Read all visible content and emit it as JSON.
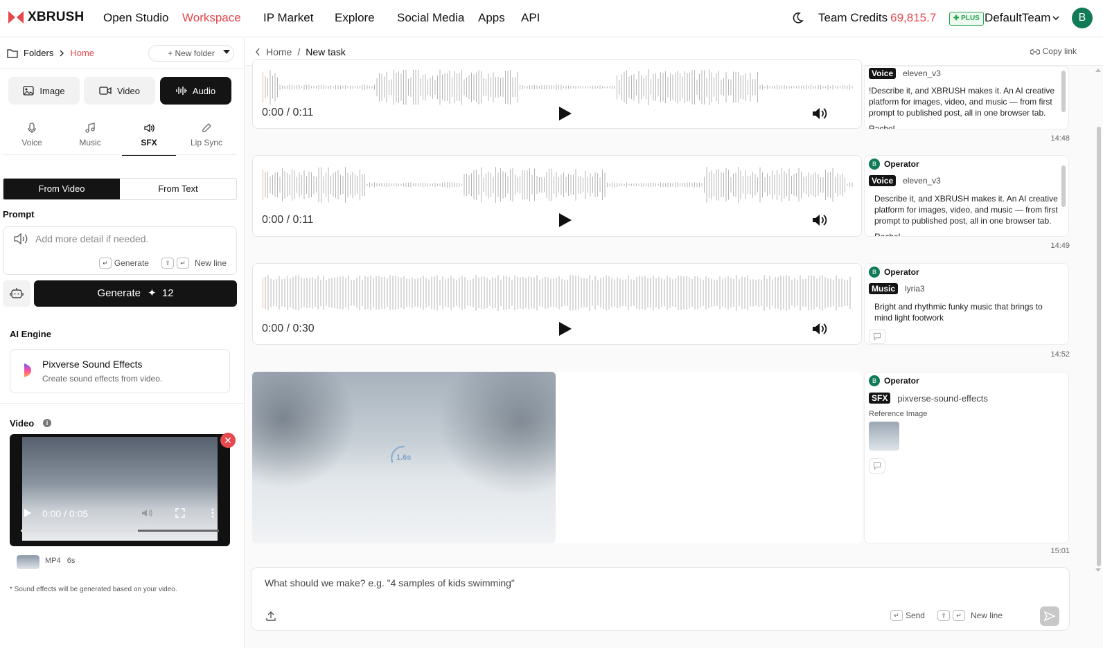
{
  "nav": {
    "brand": "XBRUSH",
    "items": [
      "Open Studio",
      "Workspace",
      "IP Market",
      "Explore",
      "Social Media",
      "Apps",
      "API"
    ],
    "active_index": 1,
    "credits_label": "Team Credits",
    "credits_value": "69,815.7",
    "plan_badge": "PLUS",
    "team_name": "DefaultTeam",
    "avatar_letter": "B"
  },
  "left": {
    "folders_label": "Folders",
    "folders_current": "Home",
    "new_folder": "+ New folder",
    "media_tabs": [
      "Image",
      "Video",
      "Audio"
    ],
    "media_active": "Audio",
    "sub_tabs": [
      "Voice",
      "Music",
      "SFX",
      "Lip Sync"
    ],
    "sub_active": "SFX",
    "source_tabs": [
      "From Video",
      "From Text"
    ],
    "prompt_label": "Prompt",
    "prompt_placeholder": "Add more detail if needed.",
    "hint_generate": "Generate",
    "hint_newline": "New line",
    "generate_label": "Generate",
    "generate_cost": "12",
    "engine_label": "AI Engine",
    "engine_name": "Pixverse Sound Effects",
    "engine_desc": "Create sound effects from video.",
    "video_label": "Video",
    "video_time": "0:00 / 0:05",
    "video_progress": 0.59,
    "file_type": "MP4",
    "file_duration": "6s",
    "note": "* Sound effects will be generated based on your video."
  },
  "main": {
    "breadcrumb_home": "Home",
    "breadcrumb_sep": "/",
    "breadcrumb_current": "New task",
    "copy_link": "Copy link",
    "cards": [
      {
        "time": "0:00 / 0:11",
        "operator": "",
        "tag": "Voice",
        "model": "eleven_v3",
        "text": "!Describe it, and XBRUSH makes it. An AI creative platform for images, video, and music — from first prompt to published post, all in one browser tab.",
        "voice": "Rachel",
        "stamp": "14:48"
      },
      {
        "time": "0:00 / 0:11",
        "operator": "Operator",
        "tag": "Voice",
        "model": "eleven_v3",
        "text": "Describe it, and XBRUSH makes it. An AI creative platform for images, video, and music — from first prompt to published post, all in one browser tab.",
        "voice": "Rachel",
        "stamp": "14:49"
      },
      {
        "time": "0:00 / 0:30",
        "operator": "Operator",
        "tag": "Music",
        "model": "lyria3",
        "text": "Bright and rhythmic funky music that brings to mind light footwork",
        "voice": "",
        "stamp": "14:52"
      }
    ],
    "video_task": {
      "operator": "Operator",
      "tag": "SFX",
      "model": "pixverse-sound-effects",
      "ref_label": "Reference Image",
      "elapsed": "1.6s",
      "stamp": "15:01"
    },
    "input_placeholder": "What should we make? e.g. \"4 samples of kids swimming\"",
    "send_label": "Send",
    "newline_label": "New line"
  },
  "colors": {
    "accent": "#e5484d",
    "dark": "#141414",
    "green": "#117a57",
    "plus": "#22a64a"
  }
}
